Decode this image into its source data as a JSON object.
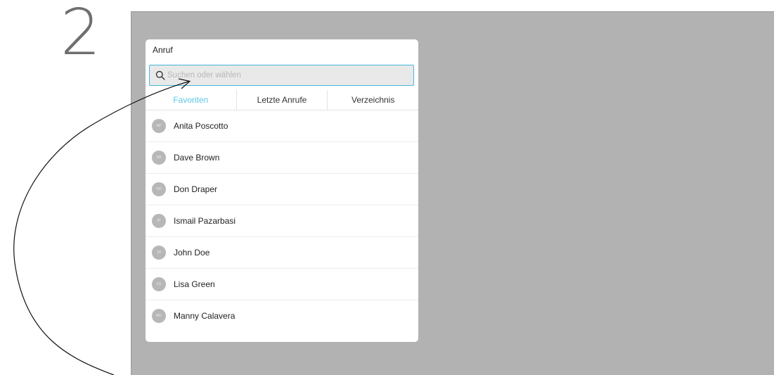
{
  "step": {
    "number": "2"
  },
  "panel": {
    "title": "Anruf",
    "search": {
      "placeholder": "Suchen oder wählen",
      "value": ""
    },
    "tabs": [
      {
        "label": "Favoriten",
        "active": true
      },
      {
        "label": "Letzte Anrufe",
        "active": false
      },
      {
        "label": "Verzeichnis",
        "active": false
      }
    ],
    "contacts": [
      {
        "initials": "AP",
        "name": "Anita Poscotto"
      },
      {
        "initials": "DB",
        "name": "Dave Brown"
      },
      {
        "initials": "DD",
        "name": "Don Draper"
      },
      {
        "initials": "IP",
        "name": "Ismail Pazarbasi"
      },
      {
        "initials": "JD",
        "name": "John Doe"
      },
      {
        "initials": "LG",
        "name": "Lisa Green"
      },
      {
        "initials": "MC",
        "name": "Manny Calavera"
      }
    ]
  },
  "colors": {
    "screen_bg": "#b2b2b2",
    "accent": "#5cc6e4",
    "search_border": "#45b6d8",
    "avatar_bg": "#b7b7b7"
  },
  "icons": {
    "search": "search-icon",
    "arrow": "callout-arrow-icon"
  }
}
